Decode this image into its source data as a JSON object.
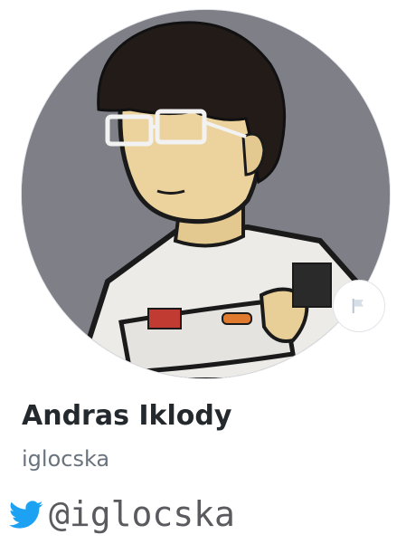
{
  "profile": {
    "full_name": "Andras Iklody",
    "username": "iglocska",
    "twitter_handle": "@iglocska"
  },
  "icons": {
    "status": "flag-icon",
    "social": "twitter-bird-icon"
  },
  "colors": {
    "twitter": "#1da1f2",
    "name": "#24292e",
    "username": "#6a737d",
    "avatar_background": "#7f8087"
  }
}
